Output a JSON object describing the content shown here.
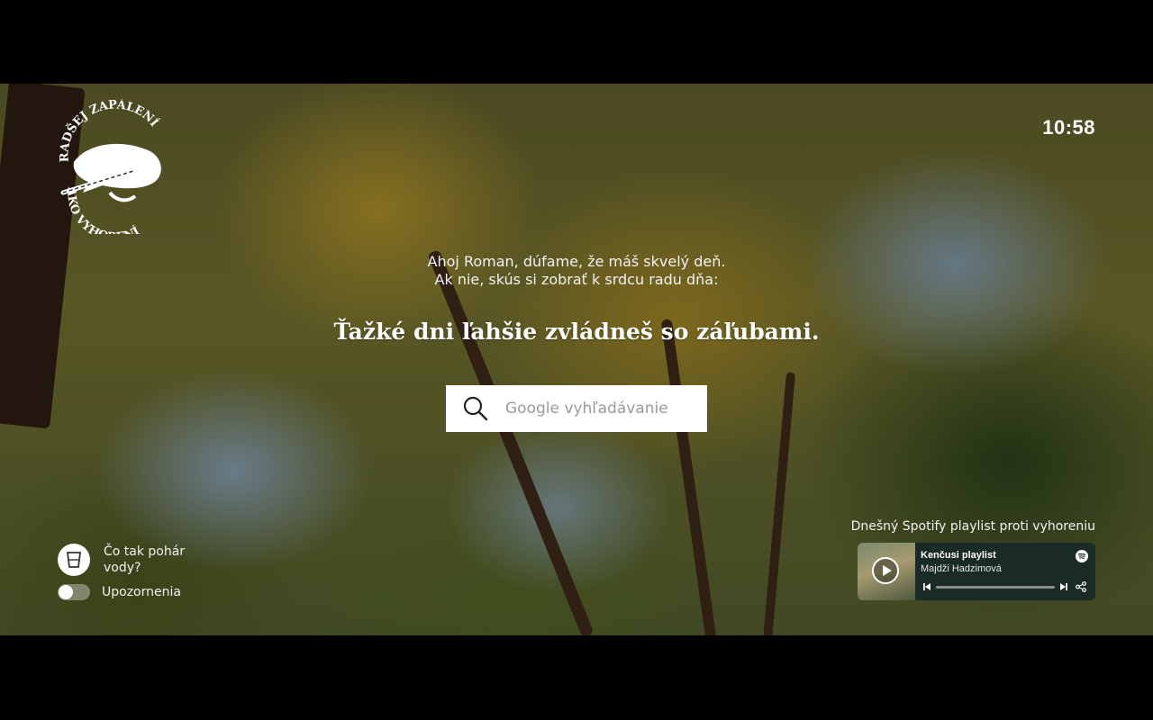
{
  "clock": {
    "time": "10:58"
  },
  "logo": {
    "top_text": "RADŠEJ ZAPÁLENÍ",
    "bottom_text": "AKO VYHORENÍ"
  },
  "greeting": {
    "line1": "Ahoj Roman, dúfame, že máš skvelý deň.",
    "line2": "Ak nie, skús si zobrať k srdcu radu dňa:"
  },
  "tip": {
    "text": "Ťažké dni ľahšie zvládneš so záľubami."
  },
  "search": {
    "placeholder": "Google vyhľadávanie",
    "icon": "search-icon"
  },
  "water_reminder": {
    "text": "Čo tak pohár vody?",
    "icon": "glass-icon"
  },
  "notifications": {
    "label": "Upozornenia",
    "enabled": false
  },
  "spotify": {
    "heading": "Dnešný Spotify playlist proti vyhoreniu",
    "track": "Kenčusi playlist",
    "artist": "Majdži Hadzimová",
    "progress": 0
  },
  "colors": {
    "letterbox": "#000000",
    "card": "#1a2a26",
    "text": "#ffffff"
  }
}
